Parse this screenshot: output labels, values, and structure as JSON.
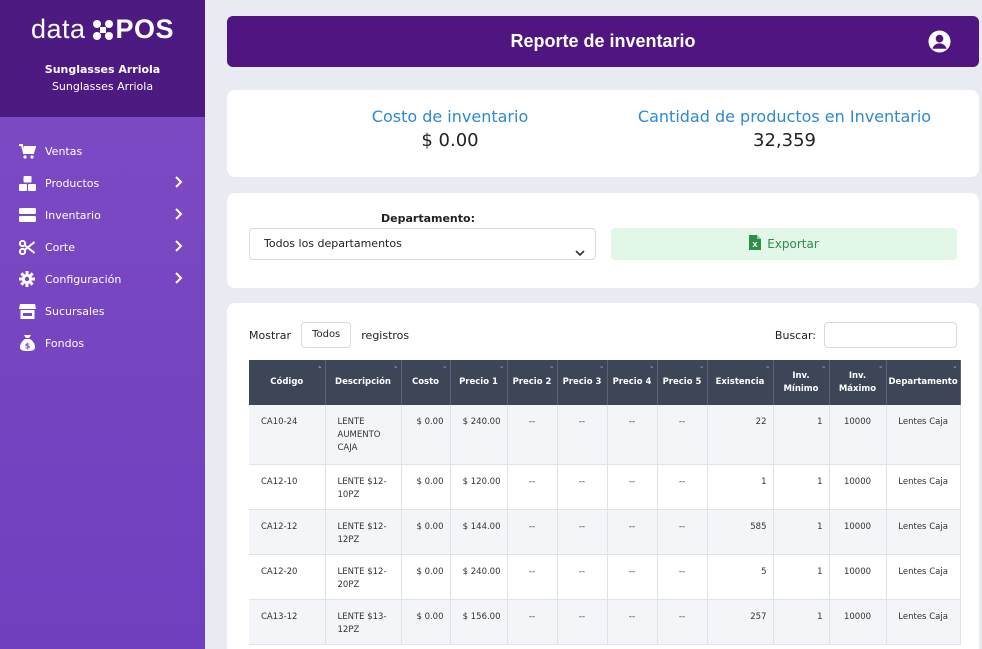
{
  "brand": {
    "light": "data",
    "bold": "POS"
  },
  "store": {
    "line1": "Sunglasses Arriola",
    "line2": "Sunglasses Arriola"
  },
  "menu": [
    {
      "label": "Ventas",
      "icon": "cart-icon",
      "submenu": false
    },
    {
      "label": "Productos",
      "icon": "boxes-icon",
      "submenu": true
    },
    {
      "label": "Inventario",
      "icon": "server-icon",
      "submenu": true
    },
    {
      "label": "Corte",
      "icon": "scissors-icon",
      "submenu": true
    },
    {
      "label": "Configuración",
      "icon": "gear-icon",
      "submenu": true
    },
    {
      "label": "Sucursales",
      "icon": "store-icon",
      "submenu": false
    },
    {
      "label": "Fondos",
      "icon": "money-bag-icon",
      "submenu": false
    }
  ],
  "header": {
    "title": "Reporte de inventario"
  },
  "stats": {
    "cost_label": "Costo de inventario",
    "cost_value": "$ 0.00",
    "qty_label": "Cantidad de productos en Inventario",
    "qty_value": "32,359"
  },
  "filters": {
    "department_label": "Departamento:",
    "department_value": "Todos los departamentos",
    "export_label": "Exportar"
  },
  "table_controls": {
    "show_label": "Mostrar",
    "length_value": "Todos",
    "records_label": "registros",
    "search_label": "Buscar:"
  },
  "table": {
    "columns": [
      "Código",
      "Descripción",
      "Costo",
      "Precio 1",
      "Precio 2",
      "Precio 3",
      "Precio 4",
      "Precio 5",
      "Existencia",
      "Inv. Mínimo",
      "Inv. Máximo",
      "Departamento"
    ],
    "rows": [
      {
        "codigo": "CA10-24",
        "descripcion": "LENTE AUMENTO CAJA",
        "costo": "$ 0.00",
        "precio1": "$ 240.00",
        "precio2": "--",
        "precio3": "--",
        "precio4": "--",
        "precio5": "--",
        "existencia": "22",
        "min": "1",
        "max": "10000",
        "depto": "Lentes Caja"
      },
      {
        "codigo": "CA12-10",
        "descripcion": "LENTE $12-10PZ",
        "costo": "$ 0.00",
        "precio1": "$ 120.00",
        "precio2": "--",
        "precio3": "--",
        "precio4": "--",
        "precio5": "--",
        "existencia": "1",
        "min": "1",
        "max": "10000",
        "depto": "Lentes Caja"
      },
      {
        "codigo": "CA12-12",
        "descripcion": "LENTE $12-12PZ",
        "costo": "$ 0.00",
        "precio1": "$ 144.00",
        "precio2": "--",
        "precio3": "--",
        "precio4": "--",
        "precio5": "--",
        "existencia": "585",
        "min": "1",
        "max": "10000",
        "depto": "Lentes Caja"
      },
      {
        "codigo": "CA12-20",
        "descripcion": "LENTE $12-20PZ",
        "costo": "$ 0.00",
        "precio1": "$ 240.00",
        "precio2": "--",
        "precio3": "--",
        "precio4": "--",
        "precio5": "--",
        "existencia": "5",
        "min": "1",
        "max": "10000",
        "depto": "Lentes Caja"
      },
      {
        "codigo": "CA13-12",
        "descripcion": "LENTE $13-12PZ",
        "costo": "$ 0.00",
        "precio1": "$ 156.00",
        "precio2": "--",
        "precio3": "--",
        "precio4": "--",
        "precio5": "--",
        "existencia": "257",
        "min": "1",
        "max": "10000",
        "depto": "Lentes Caja"
      }
    ]
  },
  "colors": {
    "sidebar": "#7e4cc4",
    "sidebar_head": "#4d1a82",
    "topbar": "#4f1580",
    "accent_blue": "#2b8ad6",
    "export_green": "#2e8f4d",
    "table_head": "#3c4657"
  }
}
